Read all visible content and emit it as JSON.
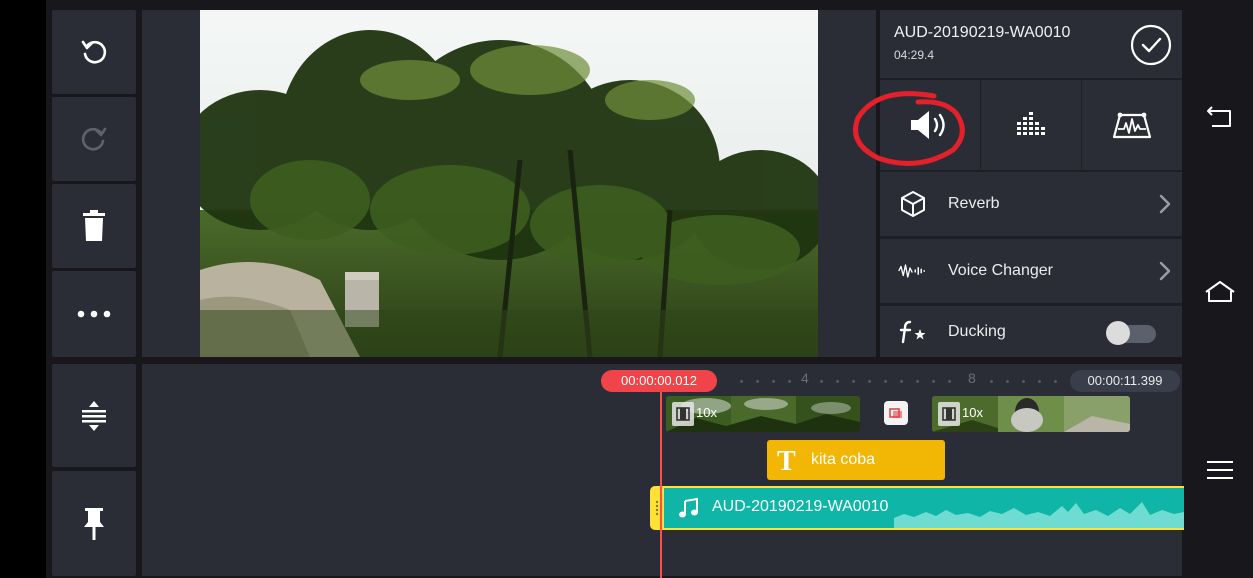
{
  "app": {
    "toolbar": {
      "undo": "undo-icon",
      "redo": "redo-icon",
      "delete": "trash-icon",
      "more": "more-icon"
    },
    "audio_panel": {
      "clip_title": "AUD-20190219-WA0010",
      "clip_duration": "04:29.4",
      "tabs": [
        {
          "name": "volume",
          "icon": "volume-icon",
          "active": true
        },
        {
          "name": "equalizer",
          "icon": "equalizer-icon",
          "active": false
        },
        {
          "name": "envelope",
          "icon": "envelope-icon",
          "active": false
        }
      ],
      "menu": {
        "reverb": "Reverb",
        "voice_changer": "Voice Changer",
        "ducking": "Ducking"
      },
      "ducking_enabled": false,
      "annotation_color": "#e4202a"
    },
    "timeline": {
      "current_time": "00:00:00.012",
      "end_time": "00:00:11.399",
      "ruler_labels": [
        "4",
        "8"
      ],
      "video_clips": [
        {
          "speed": "10x"
        },
        {
          "speed": "10x"
        }
      ],
      "text_layer": {
        "label": "kita coba",
        "icon_letter": "T",
        "color": "#f2b705"
      },
      "audio_layer": {
        "label": "AUD-20190219-WA0010",
        "color": "#0fb5a6",
        "border_color": "#ffe034"
      }
    },
    "system_nav": [
      "back-icon",
      "home-icon",
      "menu-icon"
    ]
  }
}
